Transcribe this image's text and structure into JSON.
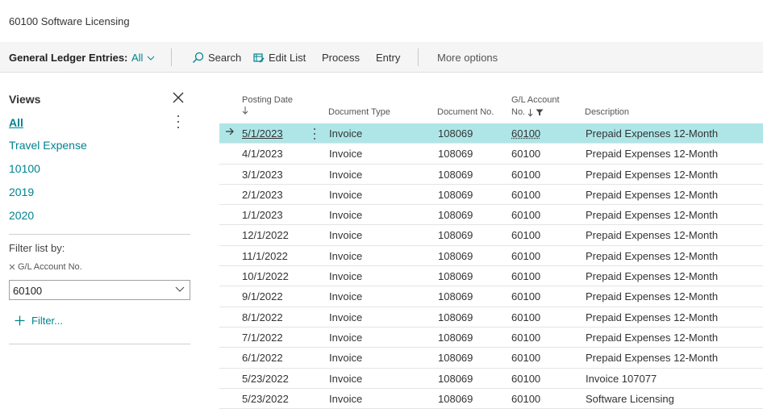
{
  "window": {
    "title": "60100 Software Licensing"
  },
  "toolbar": {
    "page_caption": "General Ledger Entries:",
    "view_selected": "All",
    "search_label": "Search",
    "edit_list_label": "Edit List",
    "process_label": "Process",
    "entry_label": "Entry",
    "more_options_label": "More options"
  },
  "sidebar": {
    "views_title": "Views",
    "views": [
      {
        "label": "All",
        "active": true
      },
      {
        "label": "Travel Expense"
      },
      {
        "label": "10100"
      },
      {
        "label": "2019"
      },
      {
        "label": "2020"
      }
    ],
    "filter_list_by": "Filter list by:",
    "filter_field_label": "G/L Account No.",
    "filter_value": "60100",
    "add_filter_label": "Filter..."
  },
  "table": {
    "columns": {
      "posting_date": "Posting Date",
      "document_type": "Document Type",
      "document_no": "Document No.",
      "gl_account_line1": "G/L Account",
      "gl_account_line2": "No.",
      "description": "Description"
    },
    "rows": [
      {
        "posting_date": "5/1/2023",
        "document_type": "Invoice",
        "document_no": "108069",
        "gl_account": "60100",
        "description": "Prepaid Expenses 12-Month",
        "selected": true
      },
      {
        "posting_date": "4/1/2023",
        "document_type": "Invoice",
        "document_no": "108069",
        "gl_account": "60100",
        "description": "Prepaid Expenses 12-Month"
      },
      {
        "posting_date": "3/1/2023",
        "document_type": "Invoice",
        "document_no": "108069",
        "gl_account": "60100",
        "description": "Prepaid Expenses 12-Month"
      },
      {
        "posting_date": "2/1/2023",
        "document_type": "Invoice",
        "document_no": "108069",
        "gl_account": "60100",
        "description": "Prepaid Expenses 12-Month"
      },
      {
        "posting_date": "1/1/2023",
        "document_type": "Invoice",
        "document_no": "108069",
        "gl_account": "60100",
        "description": "Prepaid Expenses 12-Month"
      },
      {
        "posting_date": "12/1/2022",
        "document_type": "Invoice",
        "document_no": "108069",
        "gl_account": "60100",
        "description": "Prepaid Expenses 12-Month"
      },
      {
        "posting_date": "11/1/2022",
        "document_type": "Invoice",
        "document_no": "108069",
        "gl_account": "60100",
        "description": "Prepaid Expenses 12-Month"
      },
      {
        "posting_date": "10/1/2022",
        "document_type": "Invoice",
        "document_no": "108069",
        "gl_account": "60100",
        "description": "Prepaid Expenses 12-Month"
      },
      {
        "posting_date": "9/1/2022",
        "document_type": "Invoice",
        "document_no": "108069",
        "gl_account": "60100",
        "description": "Prepaid Expenses 12-Month"
      },
      {
        "posting_date": "8/1/2022",
        "document_type": "Invoice",
        "document_no": "108069",
        "gl_account": "60100",
        "description": "Prepaid Expenses 12-Month"
      },
      {
        "posting_date": "7/1/2022",
        "document_type": "Invoice",
        "document_no": "108069",
        "gl_account": "60100",
        "description": "Prepaid Expenses 12-Month"
      },
      {
        "posting_date": "6/1/2022",
        "document_type": "Invoice",
        "document_no": "108069",
        "gl_account": "60100",
        "description": "Prepaid Expenses 12-Month"
      },
      {
        "posting_date": "5/23/2022",
        "document_type": "Invoice",
        "document_no": "108069",
        "gl_account": "60100",
        "description": "Invoice 107077"
      },
      {
        "posting_date": "5/23/2022",
        "document_type": "Invoice",
        "document_no": "108069",
        "gl_account": "60100",
        "description": "Software Licensing"
      }
    ]
  },
  "colors": {
    "accent": "#00838f",
    "selected_row": "#aee6e8",
    "toolbar_bg": "#f5f5f5"
  }
}
